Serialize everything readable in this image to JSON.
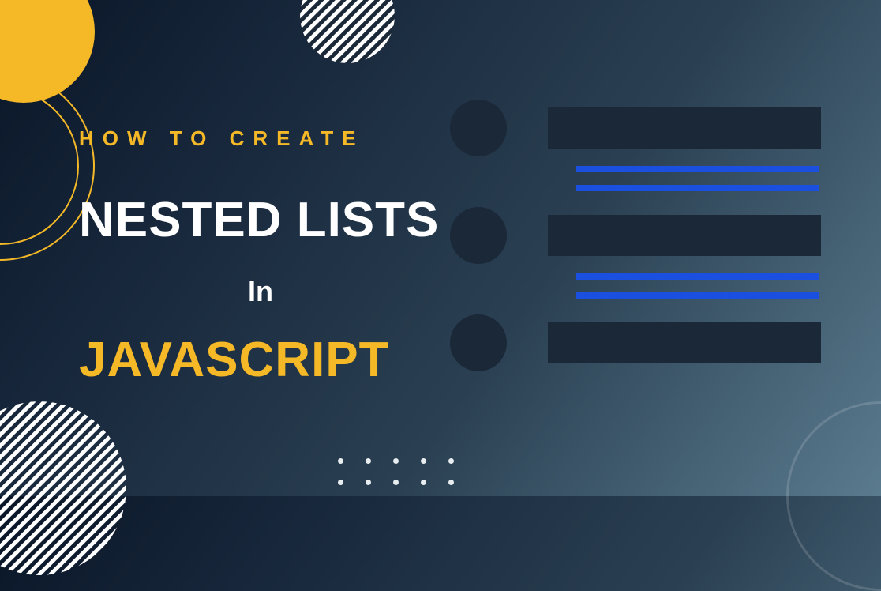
{
  "text": {
    "kicker": "HOW TO CREATE",
    "title": "NESTED LISTS",
    "connector": "In",
    "tech": "JAVASCRIPT"
  },
  "colors": {
    "accent": "#f5b928",
    "sublist": "#1b4fe0",
    "dark_block": "#1a2838"
  }
}
